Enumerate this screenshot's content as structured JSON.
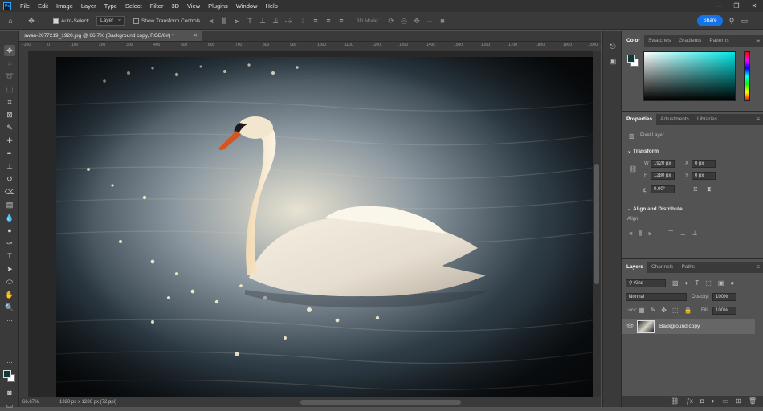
{
  "app": {
    "logo": "Ps"
  },
  "menu": [
    "File",
    "Edit",
    "Image",
    "Layer",
    "Type",
    "Select",
    "Filter",
    "3D",
    "View",
    "Plugins",
    "Window",
    "Help"
  ],
  "window_controls": [
    "—",
    "❐",
    "✕"
  ],
  "options": {
    "auto_select_label": "Auto-Select:",
    "auto_select_target": "Layer",
    "show_transform_label": "Show Transform Controls",
    "mode_3d_label": "3D Mode:",
    "share_label": "Share"
  },
  "document": {
    "tab_title": "swan-2077219_1920.jpg @ 66.7% (Background copy, RGB/8#) *",
    "zoom": "66.67%",
    "doc_info": "1920 px x 1280 px (72 ppi)"
  },
  "ruler_ticks": [
    "-100",
    "0",
    "100",
    "200",
    "300",
    "400",
    "500",
    "600",
    "700",
    "800",
    "900",
    "1000",
    "1100",
    "1200",
    "1300",
    "1400",
    "1500",
    "1600",
    "1700",
    "1800",
    "1900",
    "2000"
  ],
  "color_panel": {
    "tabs": [
      "Color",
      "Swatches",
      "Gradients",
      "Patterns"
    ],
    "foreground": "#0e3b3a",
    "background": "#ffffff"
  },
  "properties_panel": {
    "tabs": [
      "Properties",
      "Adjustments",
      "Libraries"
    ],
    "kind_label": "Pixel Layer",
    "transform_heading": "Transform",
    "w_label": "W",
    "w_value": "1920 px",
    "h_label": "H",
    "h_value": "1280 px",
    "x_label": "X",
    "x_value": "0 px",
    "y_label": "Y",
    "y_value": "0 px",
    "angle_value": "0.00°",
    "align_heading": "Align and Distribute",
    "align_label": "Align:"
  },
  "layers_panel": {
    "tabs": [
      "Layers",
      "Channels",
      "Paths"
    ],
    "filter_kind": "Kind",
    "blend_mode": "Normal",
    "opacity_label": "Opacity:",
    "opacity_value": "100%",
    "lock_label": "Lock:",
    "fill_label": "Fill:",
    "fill_value": "100%",
    "layers": [
      {
        "name": "Background copy",
        "visible": true
      }
    ]
  }
}
